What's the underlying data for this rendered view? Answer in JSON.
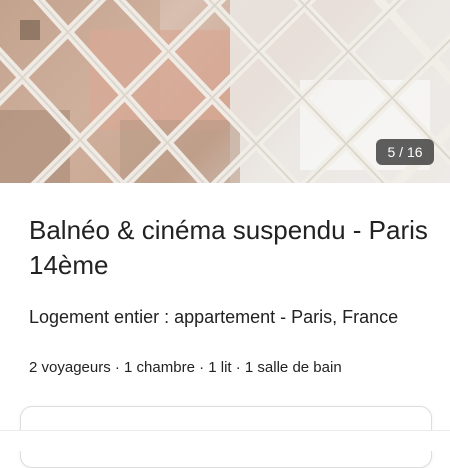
{
  "listing": {
    "photo": {
      "counter": "5 / 16",
      "description_icon": "photo-icon"
    },
    "title": "Balnéo & cinéma suspendu - Paris 14ème",
    "subtitle": "Logement entier : appartement - Paris, France",
    "details": "2 voyageurs · 1 chambre · 1 lit · 1 salle de bain"
  },
  "colors": {
    "text": "#222222",
    "counter_bg": "#222222",
    "border": "#dddddd"
  }
}
